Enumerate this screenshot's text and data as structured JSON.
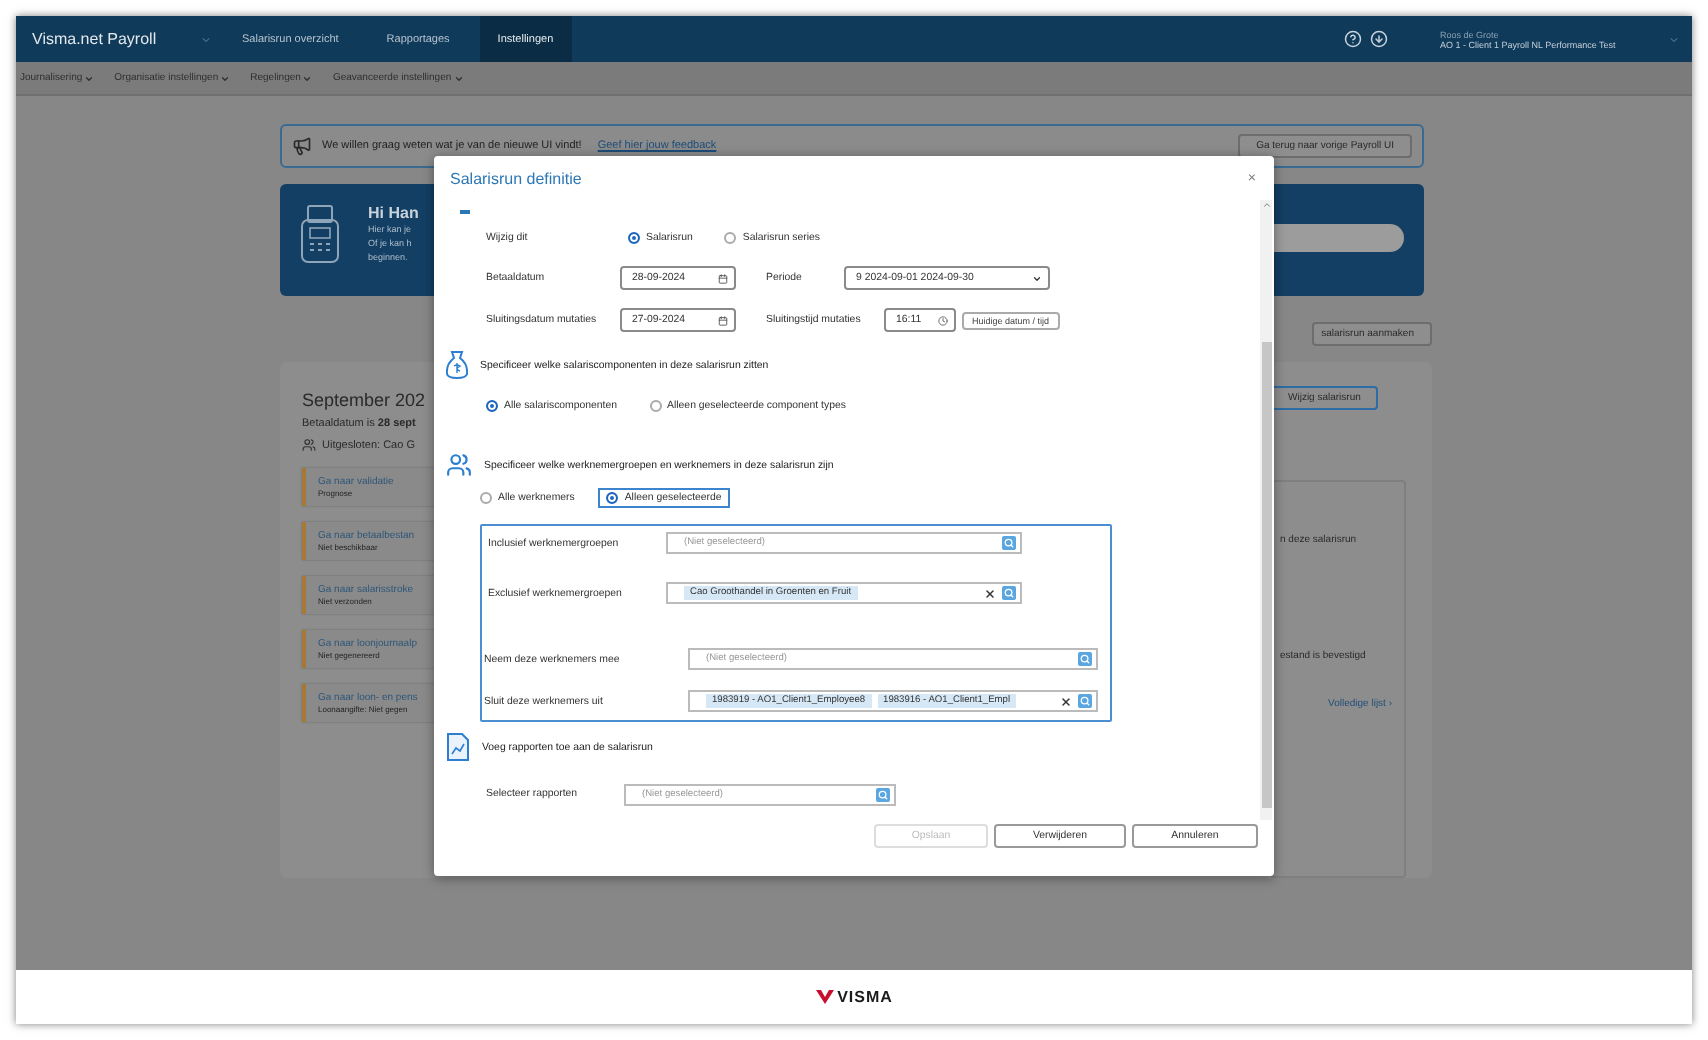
{
  "top_bar": {
    "app_name": "Visma.net Payroll",
    "nav": [
      {
        "label": "Salarisrun overzicht",
        "selected": false
      },
      {
        "label": "Rapportages",
        "selected": false
      },
      {
        "label": "Instellingen",
        "selected": true
      }
    ],
    "user": {
      "name": "Roos de Grote",
      "company": "AO 1 - Client 1 Payroll NL Performance Test"
    }
  },
  "sub_nav": [
    "Journalisering",
    "Organisatie instellingen",
    "Regelingen",
    "Geavanceerde instellingen"
  ],
  "feedback_banner": {
    "text": "We willen graag weten wat je van de nieuwe UI vindt!",
    "link": "Geef hier jouw feedback",
    "button": "Ga terug naar vorige Payroll UI"
  },
  "hero": {
    "title": "Hi Han",
    "lines": [
      "Hier kan je",
      "Of je kan h",
      "beginnen."
    ]
  },
  "new_run_button": "salarisrun aanmaken",
  "run_card": {
    "title": "September 202",
    "pay_date": "Betaaldatum is **28 sept**",
    "excluded": "Uitgesloten: Cao G",
    "steps": [
      {
        "link": "Ga naar validatie",
        "status": "Prognose"
      },
      {
        "link": "Ga naar betaalbestan",
        "status": "Niet beschikbaar"
      },
      {
        "link": "Ga naar salarisstroke",
        "status": "Niet verzonden"
      },
      {
        "link": "Ga naar loonjournaalp",
        "status": "Niet gegenereerd"
      },
      {
        "link": "Ga naar loon- en pens",
        "status": "Loonaangifte: Niet gegen"
      }
    ],
    "edit_button": "Wijzig salarisrun",
    "side_lines": [
      "n deze salarisrun",
      "estand is bevestigd"
    ],
    "full_list_link": "Volledige lijst ›"
  },
  "dialog": {
    "title": "Salarisrun definitie",
    "close": "×",
    "change_label": "Wijzig dit",
    "change_options": [
      {
        "label": "Salarisrun",
        "selected": true
      },
      {
        "label": "Salarisrun series",
        "selected": false
      }
    ],
    "field_rows": [
      [
        {
          "label": "Betaaldatum",
          "kind": "date",
          "value": "28-09-2024"
        },
        {
          "label": "Periode",
          "kind": "select",
          "value": "9 2024-09-01 2024-09-30"
        }
      ],
      [
        {
          "label": "Sluitingsdatum mutaties",
          "kind": "date",
          "value": "27-09-2024"
        },
        {
          "label": "Sluitingstijd mutaties",
          "kind": "time",
          "value": "16:11",
          "button": "Huidige datum / tijd"
        }
      ]
    ],
    "components": {
      "heading": "Specificeer welke salariscomponenten in deze salarisrun zitten",
      "options": [
        {
          "label": "Alle salariscomponenten",
          "selected": true
        },
        {
          "label": "Alleen geselecteerde component types",
          "selected": false
        }
      ]
    },
    "employees": {
      "heading": "Specificeer welke werknemergroepen en werknemers in deze salarisrun zijn",
      "options": [
        {
          "label": "Alle werknemers",
          "selected": false
        },
        {
          "label": "Alleen geselecteerde",
          "selected": true
        }
      ],
      "pickers": [
        {
          "kind": "group",
          "label": "Inclusief werknemergroepen",
          "placeholder": "(Niet geselecteerd)"
        },
        {
          "kind": "group",
          "label": "Exclusief werknemergroepen",
          "tags": [
            "Cao Groothandel in Groenten en Fruit"
          ]
        },
        {
          "kind": "person",
          "label": "Neem deze werknemers mee",
          "placeholder": "(Niet geselecteerd)"
        },
        {
          "kind": "person",
          "label": "Sluit deze werknemers uit",
          "tags": [
            "1983919 - AO1_Client1_Employee8",
            "1983916 - AO1_Client1_Empl"
          ]
        }
      ]
    },
    "reports": {
      "heading": "Voeg rapporten toe aan de salarisrun",
      "label": "Selecteer rapporten",
      "placeholder": "(Niet geselecteerd)"
    },
    "buttons": [
      {
        "label": "Opslaan",
        "disabled": true
      },
      {
        "label": "Verwijderen",
        "disabled": false
      },
      {
        "label": "Annuleren",
        "disabled": false
      }
    ]
  },
  "footer": {
    "logo": "VISMA"
  }
}
